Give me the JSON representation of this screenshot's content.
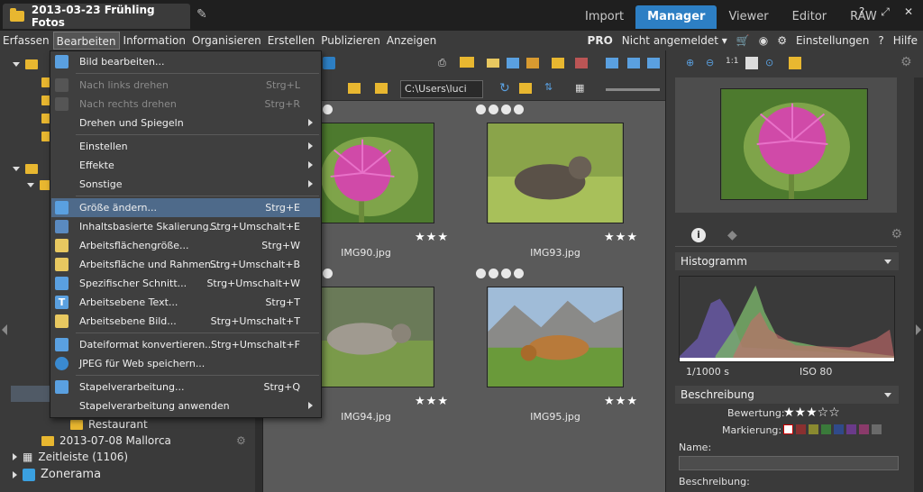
{
  "window": {
    "document_tab": "2013-03-23 Frühling Fotos",
    "modes": [
      "Import",
      "Manager",
      "Viewer",
      "Editor",
      "RAW"
    ],
    "active_mode": "Manager"
  },
  "menubar": {
    "items": [
      "Erfassen",
      "Bearbeiten",
      "Information",
      "Organisieren",
      "Erstellen",
      "Publizieren",
      "Anzeigen"
    ],
    "open_item": "Bearbeiten",
    "pro_label": "PRO",
    "login_label": "Nicht angemeldet ▾",
    "settings_label": "Einstellungen",
    "help_label": "Hilfe"
  },
  "dropdown": {
    "items": [
      {
        "label": "Bild bearbeiten...",
        "shortcut": "",
        "disabled": false,
        "submenu": false,
        "icon": "edit-icon"
      },
      {
        "label": "Nach links drehen",
        "shortcut": "Strg+L",
        "disabled": true,
        "submenu": false,
        "icon": "rotate-left-icon"
      },
      {
        "label": "Nach rechts drehen",
        "shortcut": "Strg+R",
        "disabled": true,
        "submenu": false,
        "icon": "rotate-right-icon"
      },
      {
        "label": "Drehen und Spiegeln",
        "shortcut": "",
        "disabled": false,
        "submenu": true,
        "icon": ""
      },
      {
        "label": "Einstellen",
        "shortcut": "",
        "disabled": false,
        "submenu": true,
        "icon": ""
      },
      {
        "label": "Effekte",
        "shortcut": "",
        "disabled": false,
        "submenu": true,
        "icon": ""
      },
      {
        "label": "Sonstige",
        "shortcut": "",
        "disabled": false,
        "submenu": true,
        "icon": ""
      },
      {
        "label": "Größe ändern...",
        "shortcut": "Strg+E",
        "disabled": false,
        "submenu": false,
        "icon": "resize-icon"
      },
      {
        "label": "Inhaltsbasierte Skalierung...",
        "shortcut": "Strg+Umschalt+E",
        "disabled": false,
        "submenu": false,
        "icon": "content-aware-icon"
      },
      {
        "label": "Arbeitsflächengröße...",
        "shortcut": "Strg+W",
        "disabled": false,
        "submenu": false,
        "icon": "canvas-size-icon"
      },
      {
        "label": "Arbeitsfläche und Rahmen...",
        "shortcut": "Strg+Umschalt+B",
        "disabled": false,
        "submenu": false,
        "icon": "canvas-frame-icon"
      },
      {
        "label": "Spezifischer Schnitt...",
        "shortcut": "Strg+Umschalt+W",
        "disabled": false,
        "submenu": false,
        "icon": "crop-icon"
      },
      {
        "label": "Arbeitsebene Text...",
        "shortcut": "Strg+T",
        "disabled": false,
        "submenu": false,
        "icon": "text-layer-icon"
      },
      {
        "label": "Arbeitsebene Bild...",
        "shortcut": "Strg+Umschalt+T",
        "disabled": false,
        "submenu": false,
        "icon": "image-layer-icon"
      },
      {
        "label": "Dateiformat konvertieren...",
        "shortcut": "Strg+Umschalt+F",
        "disabled": false,
        "submenu": false,
        "icon": "convert-icon"
      },
      {
        "label": "JPEG für Web speichern...",
        "shortcut": "",
        "disabled": false,
        "submenu": false,
        "icon": "web-jpeg-icon"
      },
      {
        "label": "Stapelverarbeitung...",
        "shortcut": "Strg+Q",
        "disabled": false,
        "submenu": false,
        "icon": "batch-icon"
      },
      {
        "label": "Stapelverarbeitung anwenden",
        "shortcut": "",
        "disabled": false,
        "submenu": true,
        "icon": "batch-apply-icon"
      }
    ],
    "highlighted": "Größe ändern..."
  },
  "navigator": {
    "restaurant": "Restaurant",
    "mallorca": "2013-07-08 Mallorca",
    "zeitleiste": "Zeitleiste (1106)",
    "zonerama": "Zonerama"
  },
  "toolbar": {
    "path": "C:\\Users\\luci"
  },
  "thumbnails": [
    {
      "name": "IMG90.jpg",
      "stars": "★★★"
    },
    {
      "name": "IMG93.jpg",
      "stars": "★★★"
    },
    {
      "name": "IMG94.jpg",
      "stars": "★★★"
    },
    {
      "name": "IMG95.jpg",
      "stars": "★★★"
    }
  ],
  "info_panel": {
    "histogram_title": "Histogramm",
    "shutter": "1/1000 s",
    "iso": "ISO 80",
    "description_title": "Beschreibung",
    "rating_label": "Bewertung:",
    "rating_stars": "★★★☆☆",
    "marking_label": "Markierung:",
    "name_label": "Name:",
    "description_label": "Beschreibung:"
  },
  "colors": {
    "accent": "#2d7fc4",
    "menu_highlight": "#4e6a8a",
    "folder": "#e8b730"
  }
}
